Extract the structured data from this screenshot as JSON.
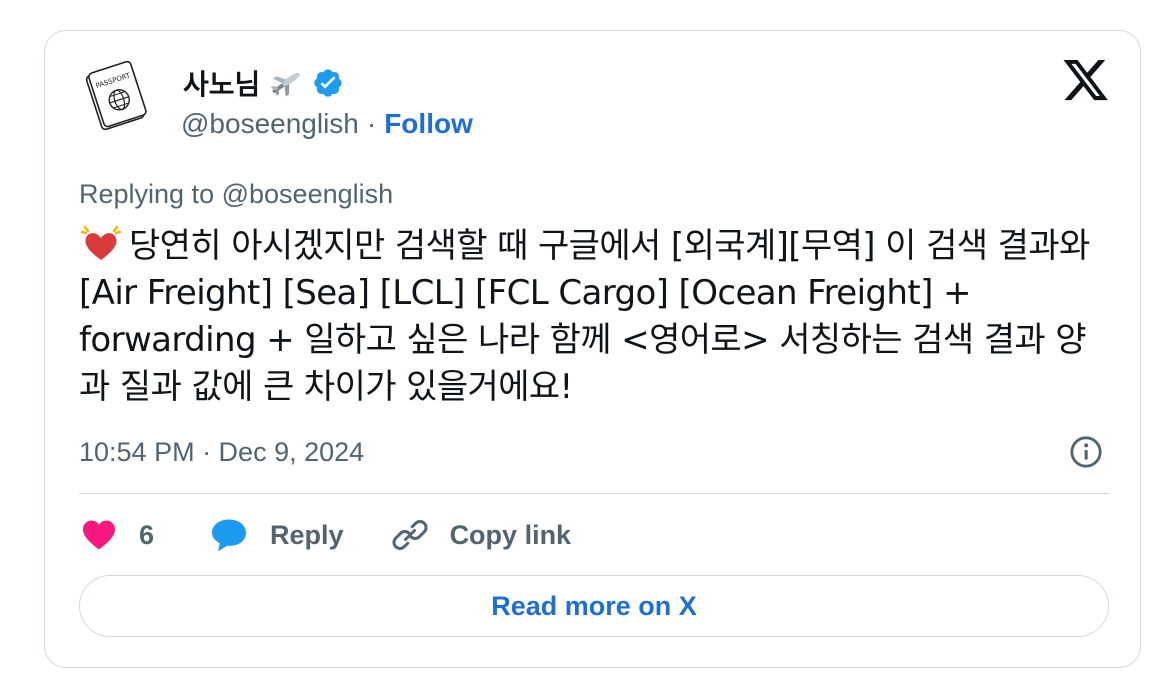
{
  "author": {
    "display_name": "사노님",
    "handle": "@boseenglish",
    "separator": "·",
    "follow_label": "Follow",
    "avatar_icon": "passport-icon",
    "avatar_text": "PASSPORT",
    "name_emoji": "airplane-icon",
    "verified": true
  },
  "tweet": {
    "replying_prefix": "Replying to",
    "replying_handle": "@boseenglish",
    "emoji": "heart-icon",
    "text": "당연히 아시겠지만 검색할 때 구글에서 [외국계][무역] 이 검색 결과와 [Air Freight] [Sea] [LCL] [FCL Cargo] [Ocean Freight] + forwarding + 일하고 싶은 나라 함께 <영어로> 서칭하는 검색 결과 양과 질과 값에 큰 차이가 있을거에요!",
    "timestamp": "10:54 PM · Dec 9, 2024"
  },
  "actions": {
    "like_count": "6",
    "reply_label": "Reply",
    "copy_label": "Copy link"
  },
  "read_more_label": "Read more on X",
  "colors": {
    "accent": "#1d6fd6",
    "muted": "#536471",
    "border": "#cfd9de",
    "like": "#f91880",
    "verified": "#1d9bf0",
    "reply_bubble": "#1d9bf0"
  }
}
